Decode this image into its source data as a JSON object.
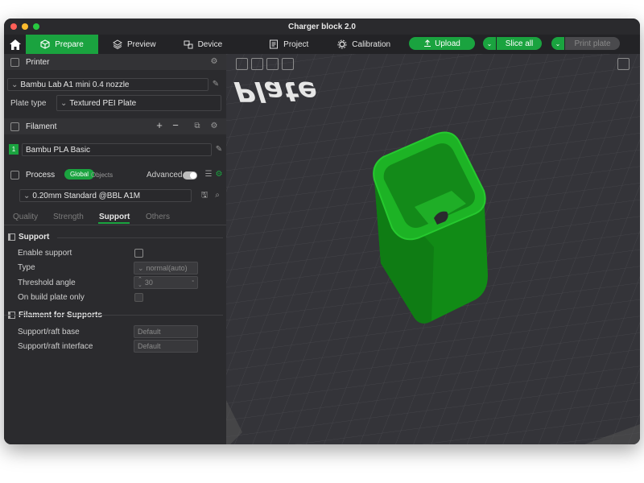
{
  "window": {
    "title": "Charger block 2.0"
  },
  "nav": {
    "tabs": [
      {
        "label": "Prepare",
        "icon": "cube-icon",
        "active": true
      },
      {
        "label": "Preview",
        "icon": "layers-icon",
        "active": false
      },
      {
        "label": "Device",
        "icon": "device-icon",
        "active": false
      },
      {
        "label": "Project",
        "icon": "project-icon",
        "active": false
      },
      {
        "label": "Calibration",
        "icon": "gear-icon",
        "active": false
      }
    ],
    "upload_label": "Upload",
    "slice_label": "Slice all",
    "print_label": "Print plate"
  },
  "printer": {
    "section_label": "Printer",
    "model": "Bambu Lab A1 mini 0.4 nozzle",
    "plate_type_label": "Plate type",
    "plate_type_value": "Textured PEI Plate"
  },
  "filament": {
    "section_label": "Filament",
    "slots": [
      {
        "index": "1",
        "name": "Bambu PLA Basic",
        "color": "#1aa33f"
      }
    ]
  },
  "process": {
    "section_label": "Process",
    "global_label": "Global",
    "objects_label": "Objects",
    "advanced_label": "Advanced",
    "preset": "0.20mm Standard @BBL A1M",
    "subtabs": [
      {
        "label": "Quality",
        "active": false
      },
      {
        "label": "Strength",
        "active": false
      },
      {
        "label": "Support",
        "active": true
      },
      {
        "label": "Others",
        "active": false
      }
    ],
    "support_group": {
      "label": "Support",
      "enable_support_label": "Enable support",
      "type_label": "Type",
      "type_value": "normal(auto)",
      "threshold_label": "Threshold angle",
      "threshold_value": "30",
      "build_plate_only_label": "On build plate only"
    },
    "filament_supports_group": {
      "label": "Filament for Supports",
      "base_label": "Support/raft base",
      "base_value": "Default",
      "interface_label": "Support/raft interface",
      "interface_value": "Default"
    }
  },
  "viewport": {
    "plate_text": "Plate",
    "model_color": "#18a41e"
  }
}
